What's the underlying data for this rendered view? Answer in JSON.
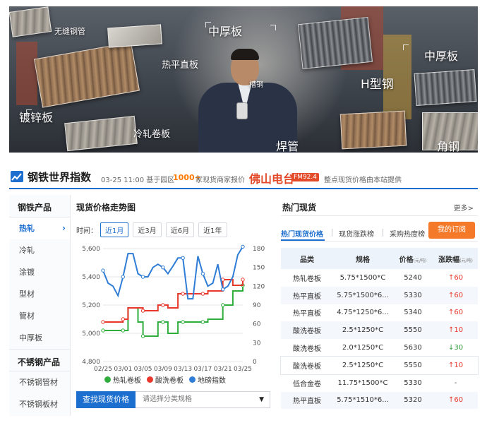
{
  "banner": {
    "tags": [
      "无缝钢管",
      "中厚板",
      "热平直板",
      "中厚板",
      "H型钢",
      "镀锌板",
      "冷轧卷板",
      "焊管",
      "角钢",
      "槽钢"
    ]
  },
  "header": {
    "title": "钢铁世界指数",
    "updated": "03-25 11:00 基于园区",
    "count": "1000+",
    "count_suffix": "家现货商家报价",
    "radio_logo": "佛山电台",
    "radio_freq": "FM92.4",
    "provider": "整点现货价格由本站提供"
  },
  "sidebar": {
    "steel_heading": "钢铁产品",
    "steel_items": [
      "热轧",
      "冷轧",
      "涂镀",
      "型材",
      "管材",
      "中厚板"
    ],
    "stainless_heading": "不锈钢产品",
    "stainless_items": [
      "不锈钢管材",
      "不锈钢板材"
    ],
    "active_chevron": "›"
  },
  "chart_section": {
    "title": "现货价格走势图",
    "time_label": "时间：",
    "ranges": [
      "近1月",
      "近3月",
      "近6月",
      "近1年"
    ],
    "search_button": "查找现货价格",
    "select_placeholder": "请选择分类规格"
  },
  "chart_data": {
    "type": "line",
    "x": [
      "02-25",
      "02-26",
      "02-27",
      "02-28",
      "03-01",
      "03-02",
      "03-03",
      "03-04",
      "03-05",
      "03-06",
      "03-07",
      "03-08",
      "03-09",
      "03-10",
      "03-11",
      "03-12",
      "03-13",
      "03-14",
      "03-15",
      "03-16",
      "03-17",
      "03-18",
      "03-19",
      "03-20",
      "03-21",
      "03-22",
      "03-23",
      "03-24",
      "03-25"
    ],
    "xtick_labels": [
      "02/25",
      "03/01",
      "03/05",
      "03/09",
      "03/13",
      "03/17",
      "03/21",
      "03/25"
    ],
    "y_left_ticks": [
      "4,800",
      "5,000",
      "5,200",
      "5,400",
      "5,600"
    ],
    "y_right_ticks": [
      "0",
      "30",
      "60",
      "90",
      "120",
      "150",
      "180"
    ],
    "ylim_left": [
      4800,
      5600
    ],
    "ylim_right": [
      0,
      180
    ],
    "series": [
      {
        "name": "热轧卷板",
        "color": "#2fae3d",
        "axis": "left",
        "values": [
          5020,
          5020,
          5020,
          5020,
          5020,
          5180,
          5180,
          5080,
          4980,
          4980,
          4980,
          5080,
          5080,
          5000,
          5000,
          5080,
          5080,
          5080,
          5080,
          5080,
          5080,
          5100,
          5100,
          5100,
          5200,
          5200,
          5300,
          5300,
          5340
        ]
      },
      {
        "name": "酸洗卷板",
        "color": "#e8382b",
        "axis": "left",
        "values": [
          5080,
          5080,
          5080,
          5080,
          5100,
          5180,
          5180,
          5180,
          5160,
          5160,
          5160,
          5200,
          5200,
          5180,
          5180,
          5280,
          5280,
          5280,
          5280,
          5280,
          5280,
          5300,
          5300,
          5300,
          5380,
          5380,
          5340,
          5340,
          5380
        ]
      },
      {
        "name": "地磅指数",
        "color": "#2f7dd6",
        "axis": "right",
        "values": [
          145,
          125,
          120,
          105,
          135,
          172,
          172,
          140,
          135,
          135,
          150,
          155,
          150,
          140,
          152,
          165,
          165,
          100,
          100,
          168,
          140,
          120,
          125,
          155,
          115,
          120,
          135,
          170,
          183
        ]
      }
    ]
  },
  "hot_section": {
    "title": "热门现货",
    "more": "更多>",
    "tabs": [
      "热门现货价格",
      "现货涨跌榜",
      "采购热度榜"
    ],
    "subscribe_button": "我的订阅",
    "columns": {
      "name": "品类",
      "spec": "规格",
      "price": "价格",
      "price_unit": "(元/吨)",
      "change": "涨跌幅",
      "change_unit": "(元/吨)"
    },
    "rows": [
      {
        "name": "热轧卷板",
        "spec": "5.75*1500*C",
        "price": "5240",
        "change": "60",
        "dir": "up",
        "arrow": "↑"
      },
      {
        "name": "热平直板",
        "spec": "5.75*1500*6...",
        "price": "5330",
        "change": "60",
        "dir": "up",
        "arrow": "↑"
      },
      {
        "name": "热平直板",
        "spec": "4.75*1250*6...",
        "price": "5340",
        "change": "60",
        "dir": "up",
        "arrow": "↑"
      },
      {
        "name": "酸洗卷板",
        "spec": "2.5*1250*C",
        "price": "5550",
        "change": "10",
        "dir": "up",
        "arrow": "↑"
      },
      {
        "name": "酸洗卷板",
        "spec": "2.0*1250*C",
        "price": "5630",
        "change": "30",
        "dir": "down",
        "arrow": "↓"
      },
      {
        "name": "酸洗卷板",
        "spec": "2.5*1250*C",
        "price": "5550",
        "change": "10",
        "dir": "up",
        "arrow": "↑"
      },
      {
        "name": "低合金卷",
        "spec": "11.75*1500*C",
        "price": "5330",
        "change": "-",
        "dir": "flat",
        "arrow": ""
      },
      {
        "name": "热平直板",
        "spec": "5.75*1510*6...",
        "price": "5320",
        "change": "60",
        "dir": "up",
        "arrow": "↑"
      }
    ]
  }
}
